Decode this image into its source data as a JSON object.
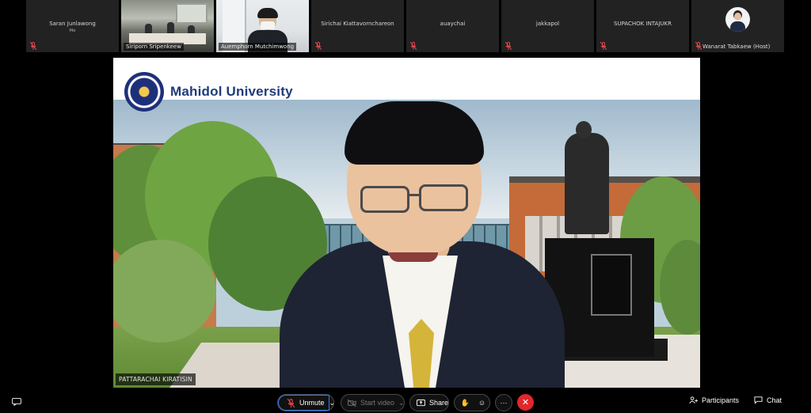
{
  "participants": [
    {
      "name": "Saran Junlawong",
      "sub": "Me",
      "type": "name",
      "muted": true
    },
    {
      "name": "Siriporn Sripenkeew",
      "type": "video-room",
      "muted": false
    },
    {
      "name": "Auemphorn Mutchimwong",
      "type": "video-office",
      "muted": false
    },
    {
      "name": "Sirichai Kiattavornchareon",
      "type": "name",
      "muted": true
    },
    {
      "name": "auaychai",
      "type": "name",
      "muted": true
    },
    {
      "name": "jakkapol",
      "type": "name",
      "muted": true
    },
    {
      "name": "SUPACHOK INTAJUKR",
      "type": "name",
      "muted": true
    },
    {
      "name": "Wanarat Tabkaew (Host)",
      "type": "avatar",
      "muted": true
    }
  ],
  "main_video": {
    "speaker_name": "PATTARACHAI KIRATISIN",
    "background_brand": "Mahidol University"
  },
  "toolbar": {
    "unmute_label": "Unmute",
    "start_video_label": "Start video",
    "share_label": "Share",
    "more_label": "···",
    "leave_label": "✕",
    "participants_label": "Participants",
    "chat_label": "Chat"
  },
  "colors": {
    "accent": "#2d7df6",
    "leave": "#e0272c",
    "muted": "#e0474c"
  }
}
